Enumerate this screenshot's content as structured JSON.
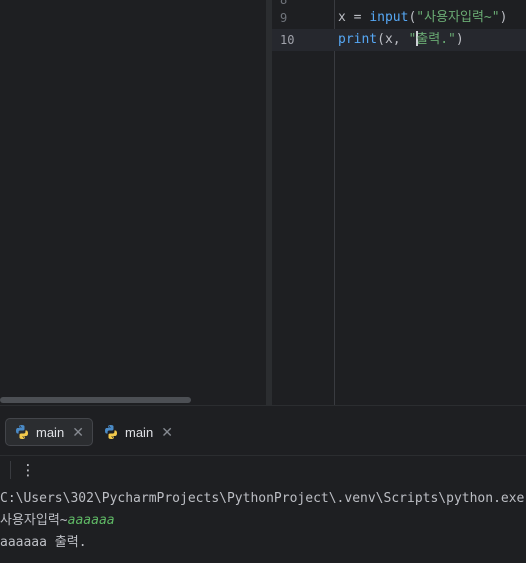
{
  "editor": {
    "partial_line_number": "8",
    "lines": [
      {
        "number": "9",
        "var": "x",
        "op": " = ",
        "fn": "input",
        "open": "(",
        "str": "\"사용자입력~\"",
        "close": ")"
      },
      {
        "number": "10",
        "fn": "print",
        "open": "(",
        "arg": "x, ",
        "str_quote": "\"",
        "str_rest": "출력.\"",
        "close": ")"
      }
    ]
  },
  "run_tabs": [
    {
      "label": "main",
      "active": true,
      "icon": "python-icon",
      "close": "✕"
    },
    {
      "label": "main",
      "active": false,
      "icon": "python-icon",
      "close": "✕"
    }
  ],
  "toolbar": {
    "more_icon": "⋮"
  },
  "console": {
    "command": "C:\\Users\\302\\PycharmProjects\\PythonProject\\.venv\\Scripts\\python.exe",
    "prompt": "사용자입력~",
    "user_input": "aaaaaa",
    "output": "aaaaaa 출력."
  },
  "colors": {
    "background": "#1e1f22",
    "string": "#6aab73",
    "function": "#56a8f5",
    "console_input": "#5fb865"
  }
}
